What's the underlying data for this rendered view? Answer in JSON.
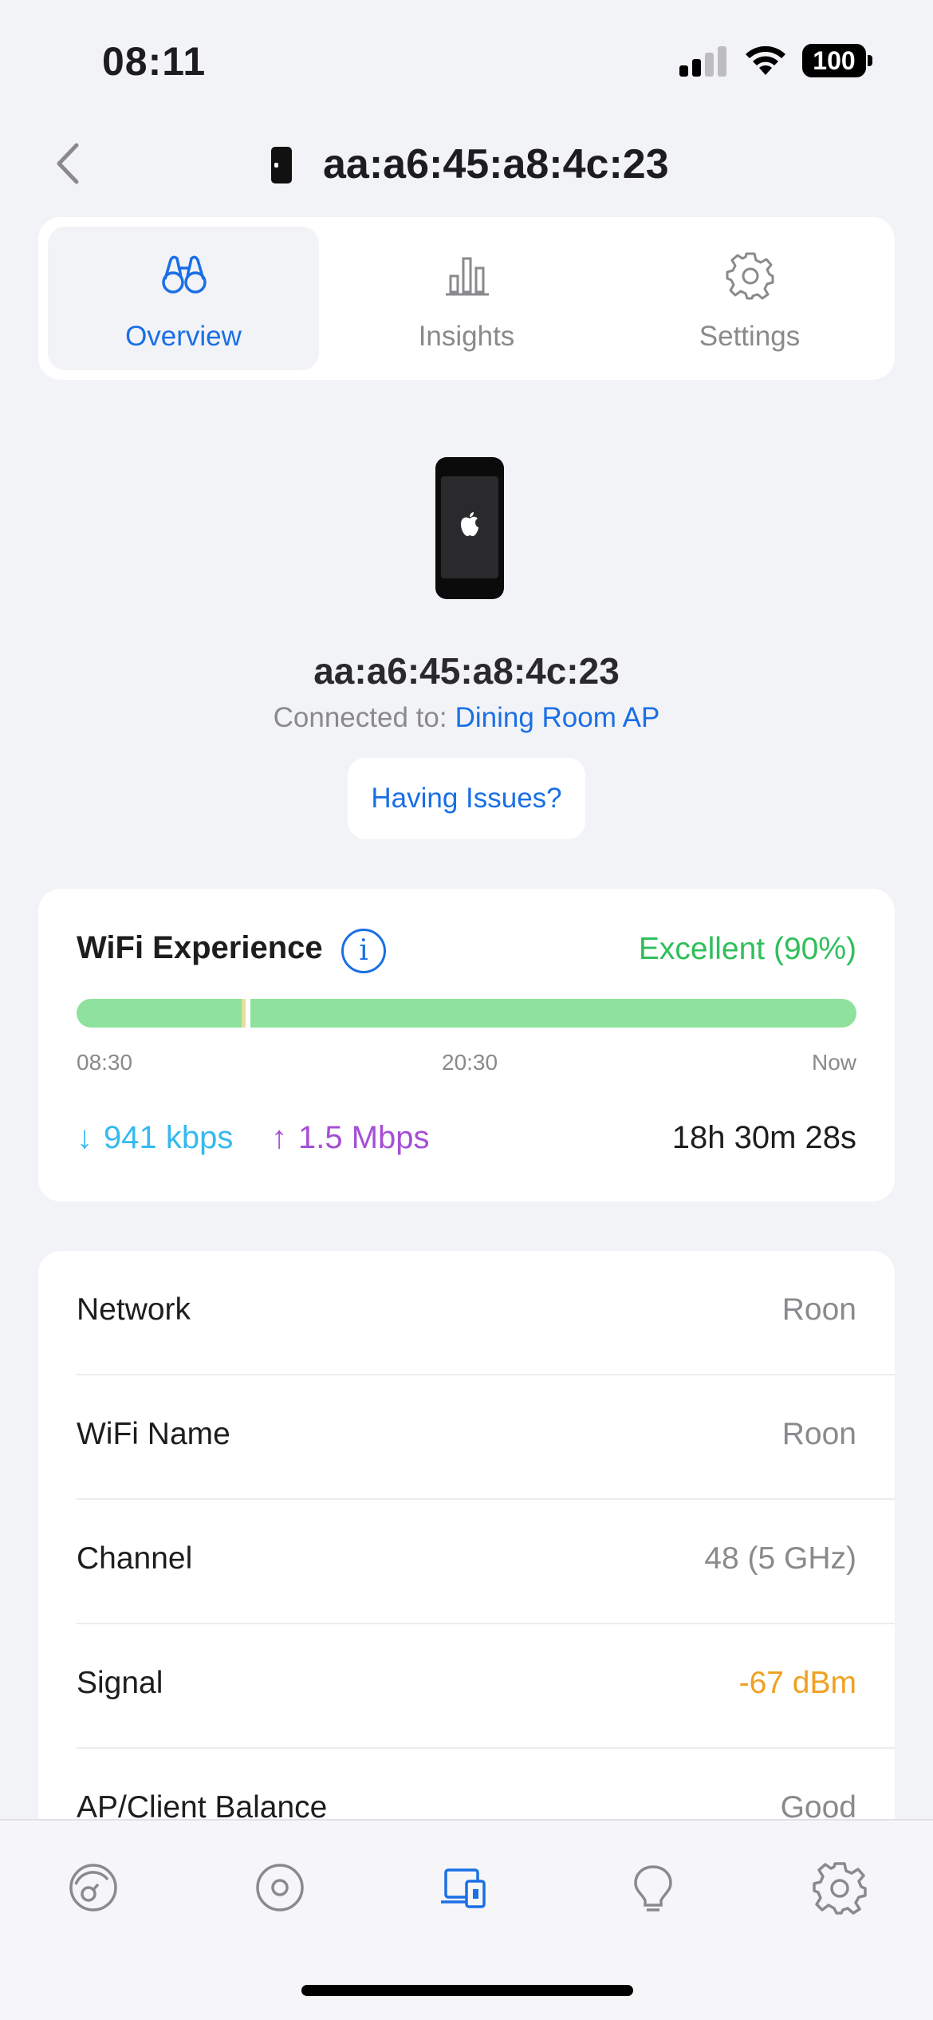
{
  "status_bar": {
    "time": "08:11",
    "battery": "100"
  },
  "header": {
    "title": "aa:a6:45:a8:4c:23"
  },
  "tabs": [
    {
      "label": "Overview",
      "icon": "binoculars-icon",
      "active": true
    },
    {
      "label": "Insights",
      "icon": "bar-chart-icon",
      "active": false
    },
    {
      "label": "Settings",
      "icon": "gear-icon",
      "active": false
    }
  ],
  "device": {
    "name": "aa:a6:45:a8:4c:23",
    "connected_label": "Connected to:",
    "connected_ap": "Dining Room AP",
    "issues_button": "Having Issues?"
  },
  "wifi_experience": {
    "title": "WiFi Experience",
    "score": "Excellent (90%)",
    "time_labels": [
      "08:30",
      "20:30",
      "Now"
    ],
    "download": "941 kbps",
    "upload": "1.5 Mbps",
    "uptime": "18h 30m 28s",
    "colors": {
      "good": "#8ee29e",
      "score": "#2fbf5a",
      "download": "#36b9f0",
      "upload": "#a64fd6"
    }
  },
  "details": [
    {
      "label": "Network",
      "value": "Roon"
    },
    {
      "label": "WiFi Name",
      "value": "Roon"
    },
    {
      "label": "Channel",
      "value": "48 (5 GHz)"
    },
    {
      "label": "Signal",
      "value": "-67 dBm",
      "color": "#f0a020"
    },
    {
      "label": "AP/Client Balance",
      "value": "Good"
    }
  ],
  "bottom_nav": [
    {
      "icon": "dashboard-icon"
    },
    {
      "icon": "topology-icon"
    },
    {
      "icon": "devices-icon",
      "active": true
    },
    {
      "icon": "insights-bulb-icon"
    },
    {
      "icon": "settings-icon"
    }
  ],
  "accent": "#1a6fe6"
}
